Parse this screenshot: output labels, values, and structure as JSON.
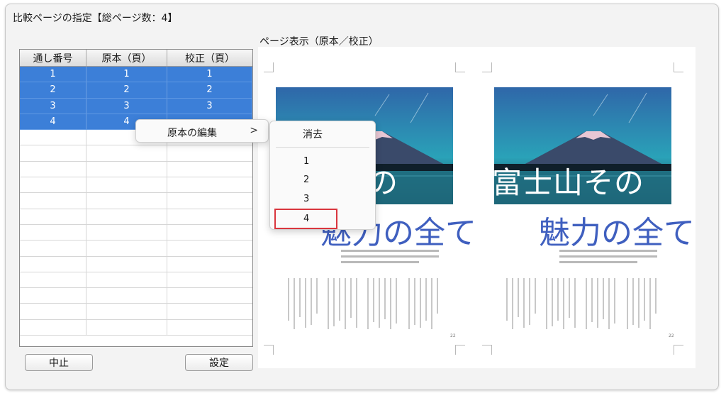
{
  "dialog": {
    "title": "比較ページの指定【総ページ数：4】"
  },
  "table": {
    "headers": [
      "通し番号",
      "原本（頁）",
      "校正（頁）"
    ],
    "rows": [
      [
        "1",
        "1",
        "1"
      ],
      [
        "2",
        "2",
        "2"
      ],
      [
        "3",
        "3",
        "3"
      ],
      [
        "4",
        "4",
        ""
      ]
    ]
  },
  "buttons": {
    "cancel": "中止",
    "set": "設定"
  },
  "preview": {
    "label": "ページ表示（原本／校正）",
    "left_title_line1": "の",
    "left_title_line2": "魅力の全て",
    "right_title_line1": "富士山その",
    "right_title_line2": "魅力の全て",
    "page_number_left": "22",
    "page_number_right": "22"
  },
  "context_menu": {
    "item": "原本の編集",
    "arrow": ">"
  },
  "submenu": {
    "delete": "消去",
    "options": [
      "1",
      "2",
      "3",
      "4"
    ]
  },
  "colors": {
    "selection": "#3c7fd8",
    "title_blue": "#3f5fbf",
    "highlight": "#d9363e"
  }
}
